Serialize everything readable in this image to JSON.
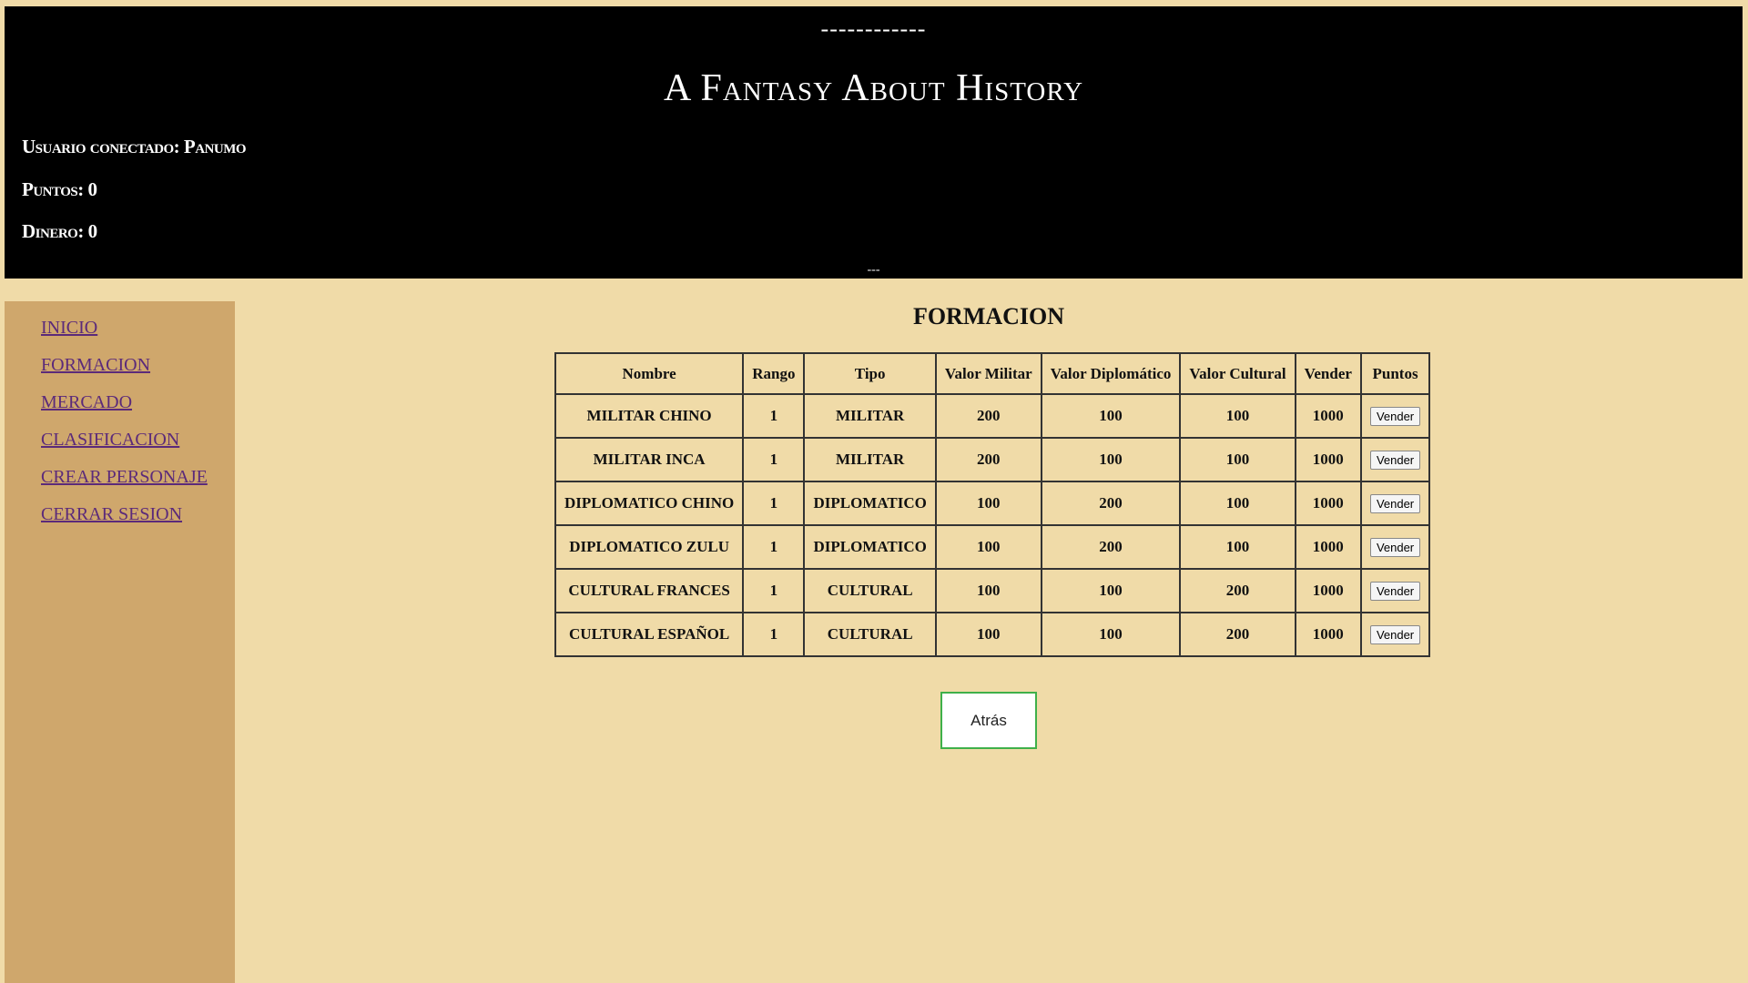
{
  "header": {
    "dashes_top": "------------",
    "title": "A Fantasy About History",
    "user_line": "Usuario conectado: Panumo",
    "points_line": "Puntos: 0",
    "money_line": "Dinero: 0",
    "dashes_bottom": "---"
  },
  "sidebar": {
    "items": [
      {
        "label": "INICIO"
      },
      {
        "label": "FORMACION"
      },
      {
        "label": "MERCADO"
      },
      {
        "label": "CLASIFICACION"
      },
      {
        "label": "CREAR PERSONAJE"
      },
      {
        "label": "CERRAR SESION"
      }
    ]
  },
  "main": {
    "title": "FORMACION",
    "table": {
      "headers": [
        "Nombre",
        "Rango",
        "Tipo",
        "Valor Militar",
        "Valor Diplomático",
        "Valor Cultural",
        "Vender",
        "Puntos"
      ],
      "rows": [
        {
          "nombre": "MILITAR CHINO",
          "rango": "1",
          "tipo": "MILITAR",
          "militar": "200",
          "diplomatico": "100",
          "cultural": "100",
          "vender": "1000",
          "action": "Vender"
        },
        {
          "nombre": "MILITAR INCA",
          "rango": "1",
          "tipo": "MILITAR",
          "militar": "200",
          "diplomatico": "100",
          "cultural": "100",
          "vender": "1000",
          "action": "Vender"
        },
        {
          "nombre": "DIPLOMATICO CHINO",
          "rango": "1",
          "tipo": "DIPLOMATICO",
          "militar": "100",
          "diplomatico": "200",
          "cultural": "100",
          "vender": "1000",
          "action": "Vender"
        },
        {
          "nombre": "DIPLOMATICO ZULU",
          "rango": "1",
          "tipo": "DIPLOMATICO",
          "militar": "100",
          "diplomatico": "200",
          "cultural": "100",
          "vender": "1000",
          "action": "Vender"
        },
        {
          "nombre": "CULTURAL FRANCES",
          "rango": "1",
          "tipo": "CULTURAL",
          "militar": "100",
          "diplomatico": "100",
          "cultural": "200",
          "vender": "1000",
          "action": "Vender"
        },
        {
          "nombre": "CULTURAL ESPAÑOL",
          "rango": "1",
          "tipo": "CULTURAL",
          "militar": "100",
          "diplomatico": "100",
          "cultural": "200",
          "vender": "1000",
          "action": "Vender"
        }
      ]
    },
    "back_label": "Atrás"
  },
  "colors": {
    "page_background": "#f0dba8",
    "header_background": "#000000",
    "sidebar_background": "#cfa76c",
    "link_color": "#5b2a7a",
    "back_button_border": "#3fb04a"
  }
}
